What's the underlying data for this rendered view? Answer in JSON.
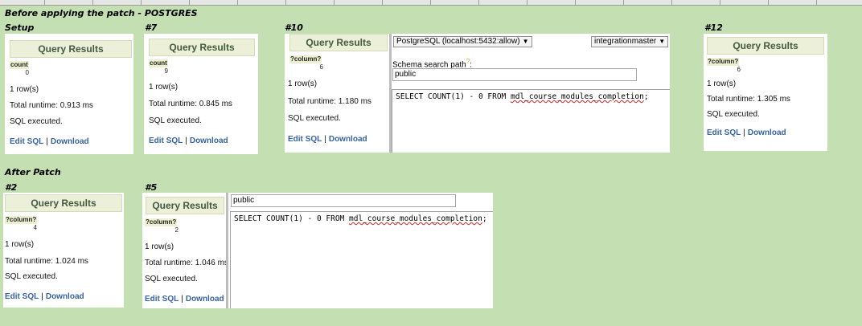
{
  "labels": {
    "title": "Before applying the patch - POSTGRES",
    "setup": "Setup",
    "n7": "#7",
    "n10": "#10",
    "n12": "#12",
    "after_patch": "After Patch",
    "n2": "#2",
    "n5": "#5"
  },
  "panels": {
    "setup": {
      "head": "Query Results",
      "colname": "count",
      "colval": "0",
      "rows": "1 row(s)",
      "runtime": "Total runtime: 0.913 ms",
      "status": "SQL executed.",
      "edit": "Edit SQL",
      "sep": "|",
      "download": "Download"
    },
    "p7": {
      "head": "Query Results",
      "colname": "count",
      "colval": "9",
      "rows": "1 row(s)",
      "runtime": "Total runtime: 0.845 ms",
      "status": "SQL executed.",
      "edit": "Edit SQL",
      "sep": "|",
      "download": "Download"
    },
    "p10": {
      "head": "Query Results",
      "colname": "?column?",
      "colval": "6",
      "rows": "1 row(s)",
      "runtime": "Total runtime: 1.180 ms",
      "status": "SQL executed.",
      "edit": "Edit SQL",
      "sep": "|",
      "download": "Download"
    },
    "p12": {
      "head": "Query Results",
      "colname": "?column?",
      "colval": "6",
      "rows": "1 row(s)",
      "runtime": "Total runtime: 1.305 ms",
      "status": "SQL executed.",
      "edit": "Edit SQL",
      "sep": "|",
      "download": "Download"
    },
    "p2": {
      "head": "Query Results",
      "colname": "?column?",
      "colval": "4",
      "rows": "1 row(s)",
      "runtime": "Total runtime: 1.024 ms",
      "status": "SQL executed.",
      "edit": "Edit SQL",
      "sep": "|",
      "download": "Download"
    },
    "p5": {
      "head": "Query Results",
      "colname": "?column?",
      "colval": "2",
      "rows": "1 row(s)",
      "runtime": "Total runtime: 1.046 ms",
      "status": "SQL executed.",
      "edit": "Edit SQL",
      "sep": "|",
      "download": "Download"
    }
  },
  "editor": {
    "server": "PostgreSQL (localhost:5432:allow)",
    "database": "integrationmaster",
    "schema_label": "Schema search path",
    "schema_help": "?",
    "schema_colon": ":",
    "schema_value": "public",
    "sql_prefix": "SELECT COUNT(1) - 0 FROM ",
    "sql_table": "mdl_course_modules_completion",
    "sql_suffix": ";"
  },
  "icons": {
    "dropdown": "chevron-down-icon"
  }
}
